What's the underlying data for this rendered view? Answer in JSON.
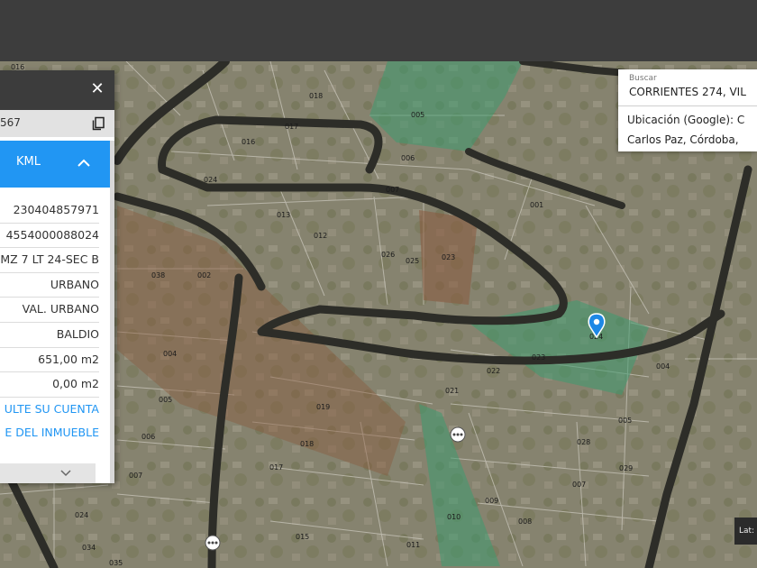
{
  "colors": {
    "accent": "#2196f3",
    "green_parcel": "#3e9a6f",
    "brown_parcel": "#8a5a3e",
    "marker": "#1e88e5"
  },
  "panel": {
    "id_partial": "567",
    "kml_prefix": "",
    "kml_label": "KML",
    "close_icon": "close-icon",
    "copy_icon": "copy-icon",
    "rows": [
      "230404857971",
      "4554000088024",
      "MZ 7 LT 24-SEC B",
      "URBANO",
      "VAL. URBANO",
      "BALDIO",
      "651,00 m2",
      "0,00 m2"
    ],
    "links": [
      "ULTE SU CUENTA",
      "E DEL INMUEBLE"
    ]
  },
  "search": {
    "label": "Buscar",
    "value": "CORRIENTES 274, VIL",
    "result_line1": "Ubicación (Google): C",
    "result_line2": "Carlos Paz, Córdoba, "
  },
  "lat_label": "Lat: -",
  "map": {
    "parcels": [
      "016",
      "018",
      "017",
      "005",
      "016",
      "006",
      "024",
      "007",
      "013",
      "001",
      "012",
      "026",
      "025",
      "023",
      "038",
      "002",
      "024",
      "004",
      "023",
      "022",
      "004",
      "005",
      "021",
      "019",
      "005",
      "006",
      "018",
      "028",
      "007",
      "017",
      "029",
      "007",
      "009",
      "010",
      "008",
      "015",
      "011",
      "034",
      "035",
      "024"
    ]
  }
}
